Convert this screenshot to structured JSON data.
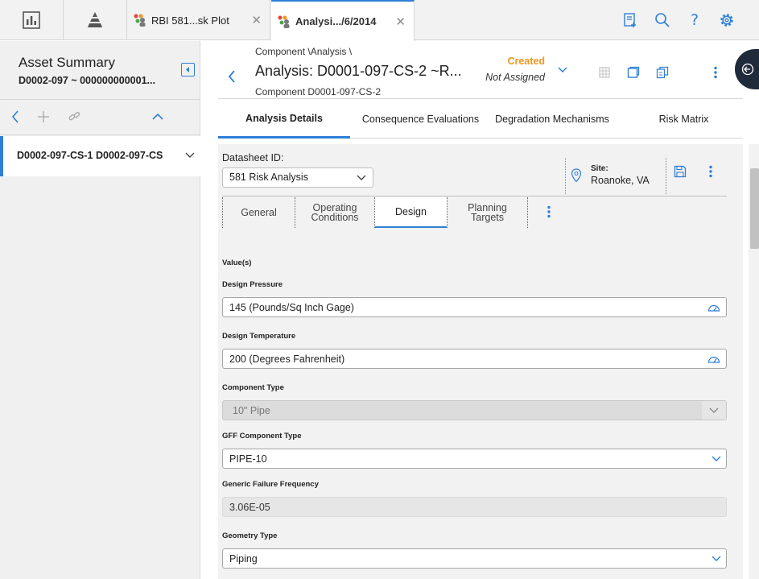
{
  "topbar": {
    "tabs": [
      {
        "label": "RBI 581...sk Plot",
        "active": false
      },
      {
        "label": "Analysi.../6/2014",
        "active": true
      }
    ]
  },
  "left": {
    "title": "Asset Summary",
    "subtitle": "D0002-097 ~ 000000000001...",
    "item": "D0002-097-CS-1 D0002-097-CS"
  },
  "header": {
    "breadcrumb": "Component \\Analysis \\",
    "title": "Analysis: D0001-097-CS-2 ~R...",
    "subtitle": "Component D0001-097-CS-2",
    "status": "Created",
    "assignee": "Not Assigned"
  },
  "main_tabs": [
    {
      "label": "Analysis Details",
      "active": true
    },
    {
      "label": "Consequence Evaluations",
      "active": false
    },
    {
      "label": "Degradation Mechanisms",
      "active": false
    },
    {
      "label": "Risk Matrix",
      "active": false
    }
  ],
  "datasheet": {
    "label": "Datasheet ID:",
    "value": "581 Risk Analysis",
    "site_label": "Site:",
    "site_value": "Roanoke, VA"
  },
  "sub_tabs": [
    {
      "line1": "General",
      "line2": "",
      "active": false
    },
    {
      "line1": "Operating",
      "line2": "Conditions",
      "active": false
    },
    {
      "line1": "Design",
      "line2": "",
      "active": true
    },
    {
      "line1": "Planning",
      "line2": "Targets",
      "active": false
    }
  ],
  "form": {
    "section": "Value(s)",
    "fields": [
      {
        "label": "Design Pressure",
        "value": "145 (Pounds/Sq Inch Gage)"
      },
      {
        "label": "Design Temperature",
        "value": "200 (Degrees Fahrenheit)"
      },
      {
        "label": "Component Type",
        "value": "10\" Pipe"
      },
      {
        "label": "GFF Component Type",
        "value": "PIPE-10"
      },
      {
        "label": "Generic Failure Frequency",
        "value": "3.06E-05"
      },
      {
        "label": "Geometry Type",
        "value": "Piping"
      }
    ]
  },
  "colors": {
    "accent": "#2f7fd7",
    "status": "#f0961e"
  }
}
